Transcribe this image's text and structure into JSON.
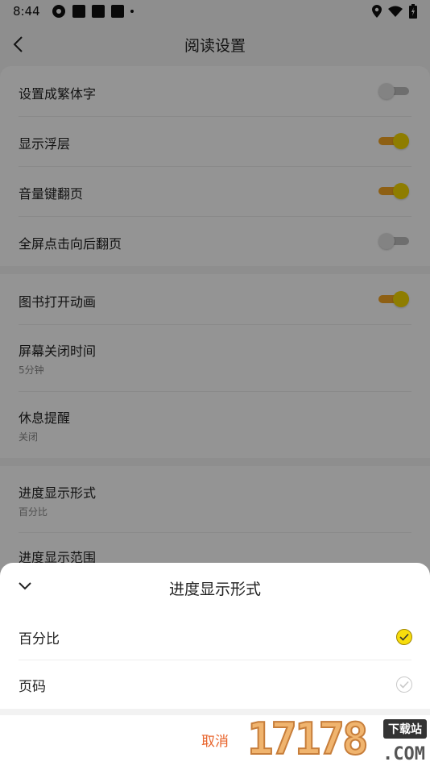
{
  "status_bar": {
    "time": "8:44",
    "icons": [
      "sync-icon",
      "notification-square-icon",
      "notification-square-icon",
      "notification-square-icon",
      "more-dot-icon",
      "location-icon",
      "wifi-icon",
      "battery-charging-icon"
    ]
  },
  "header": {
    "title": "阅读设置"
  },
  "settings": {
    "group1": [
      {
        "label": "设置成繁体字",
        "toggle": false
      },
      {
        "label": "显示浮层",
        "toggle": true
      },
      {
        "label": "音量键翻页",
        "toggle": true
      },
      {
        "label": "全屏点击向后翻页",
        "toggle": false
      }
    ],
    "group2": {
      "book_animation": {
        "label": "图书打开动画",
        "toggle": true
      },
      "screen_off": {
        "label": "屏幕关闭时间",
        "value": "5分钟"
      },
      "rest_reminder": {
        "label": "休息提醒",
        "value": "关闭"
      }
    },
    "group3": {
      "progress_format": {
        "label": "进度显示形式",
        "value": "百分比"
      },
      "progress_range": {
        "label": "进度显示范围"
      }
    }
  },
  "sheet": {
    "title": "进度显示形式",
    "options": [
      {
        "label": "百分比",
        "selected": true
      },
      {
        "label": "页码",
        "selected": false
      }
    ],
    "cancel_label": "取消"
  },
  "watermark": {
    "digits": "17178",
    "badge": "下载站",
    "suffix": ".COM"
  },
  "colors": {
    "toggle_on_track": "#f5a623",
    "toggle_on_knob": "#f5d800",
    "selected_check": "#f7dd0d",
    "cancel_text": "#e8632a"
  }
}
